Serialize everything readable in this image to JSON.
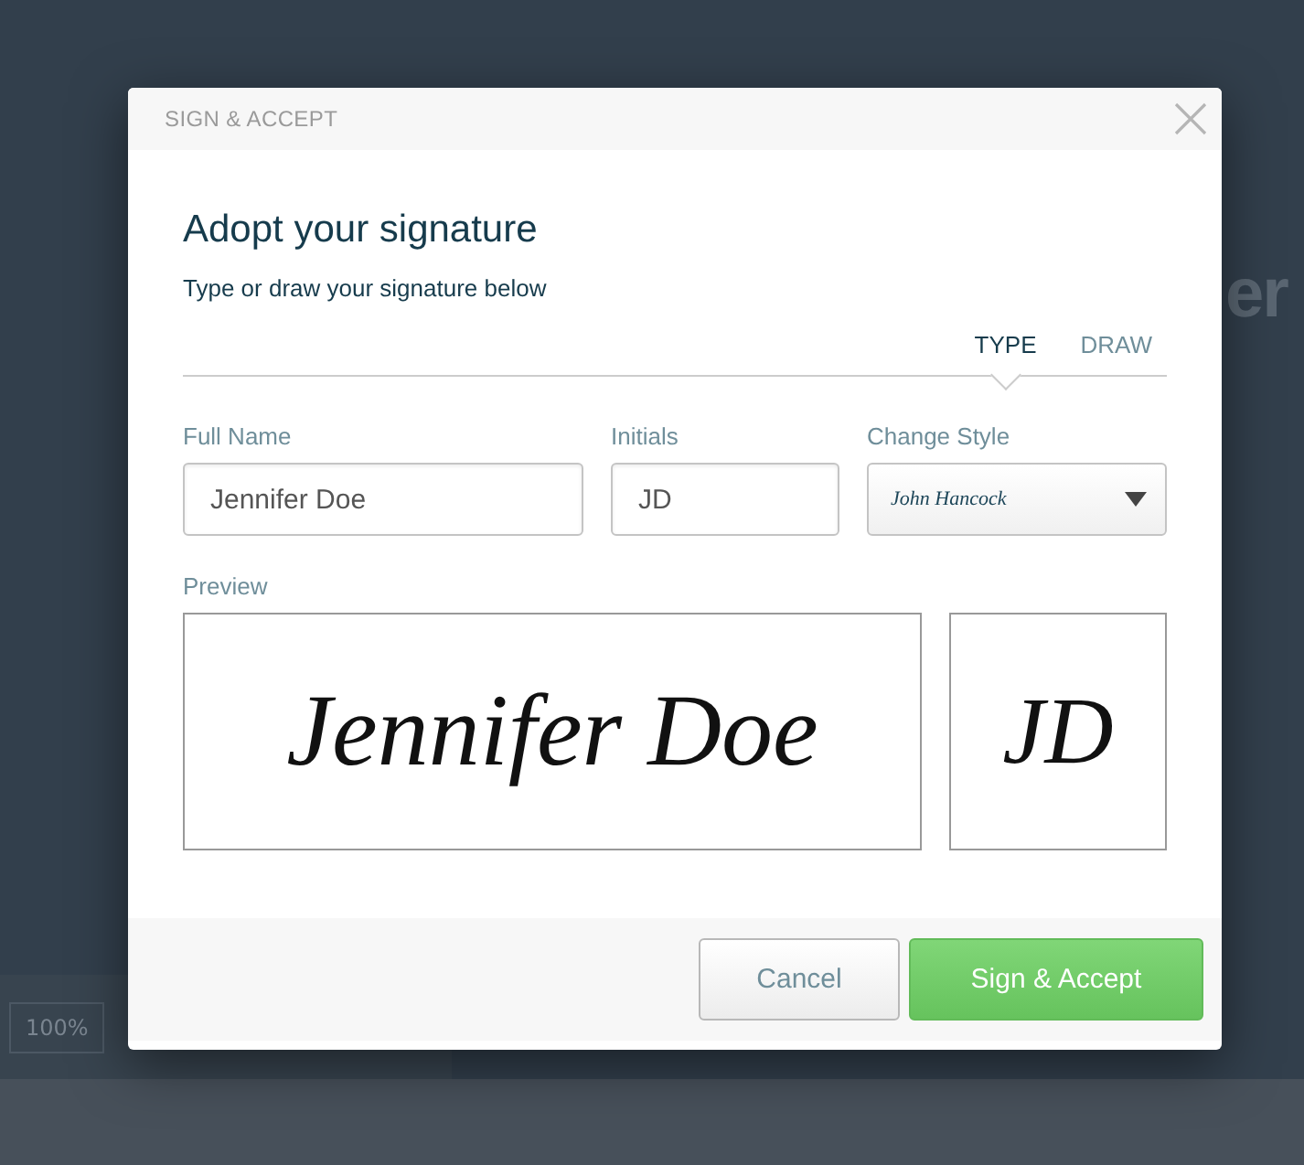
{
  "background": {
    "heading_fragment": "er",
    "zoom_select": "100%"
  },
  "dialog": {
    "header": "SIGN & ACCEPT",
    "title": "Adopt your signature",
    "subtitle": "Type or draw your signature below",
    "tabs": [
      {
        "label": "TYPE",
        "selected": true
      },
      {
        "label": "DRAW",
        "selected": false
      }
    ],
    "fields": [
      {
        "kind": "text",
        "label": "Full Name",
        "value": "Jennifer Doe"
      },
      {
        "kind": "text",
        "label": "Initials",
        "value": "JD"
      },
      {
        "kind": "select",
        "label": "Change Style",
        "value": "John Hancock"
      }
    ],
    "preview": {
      "label": "Preview",
      "signature": "Jennifer Doe",
      "initials": "JD"
    },
    "buttons": [
      {
        "kind": "secondary",
        "label": "Cancel"
      },
      {
        "kind": "primary",
        "label": "Sign & Accept"
      }
    ]
  }
}
